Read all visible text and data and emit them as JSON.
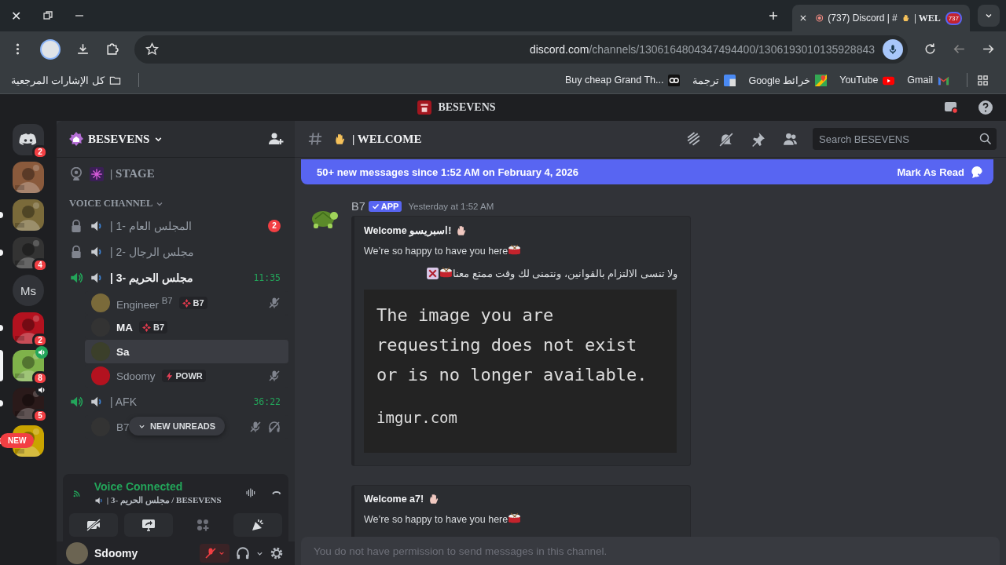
{
  "browser": {
    "window_close": "✕",
    "tab": {
      "title": "(737) Discord | #",
      "title_end": "| WEL",
      "badge": "737"
    },
    "address": {
      "domain": "discord.com",
      "path": "/channels/1306164804347494400/1306193010135928843"
    },
    "bookmarks": [
      {
        "label": "Buy cheap Grand Th...",
        "kind": "gg"
      },
      {
        "label": "ترجمة",
        "kind": "translate"
      },
      {
        "label": "Google خرائط",
        "kind": "maps"
      },
      {
        "label": "YouTube",
        "kind": "youtube"
      },
      {
        "label": "Gmail",
        "kind": "gmail"
      }
    ],
    "all_bookmarks": "كل الإشارات المرجعية"
  },
  "app_title": "BESEVENS",
  "servers": [
    {
      "kind": "home",
      "badge": "2",
      "unread": false,
      "selected": false,
      "voice": false
    },
    {
      "kind": "picture",
      "unread": false,
      "selected": false,
      "voice": false
    },
    {
      "kind": "picture",
      "unread": true,
      "selected": false,
      "voice": false
    },
    {
      "kind": "picture",
      "badge": "4",
      "unread": true,
      "selected": false,
      "voice": false
    },
    {
      "kind": "text",
      "label": "Ms",
      "unread": false,
      "selected": false,
      "voice": false
    },
    {
      "kind": "picture",
      "badge": "2",
      "unread": true,
      "selected": false,
      "voice": false
    },
    {
      "kind": "picture",
      "badge": "8",
      "unread": false,
      "selected": true,
      "voice": true
    },
    {
      "kind": "picture",
      "badge": "5",
      "unread": true,
      "selected": false,
      "voice": true
    },
    {
      "kind": "picture",
      "pill": "NEW",
      "unread": true,
      "selected": false,
      "voice": false
    }
  ],
  "sidebar": {
    "server_name": "BESEVENS",
    "stage": "| STAGE",
    "category": {
      "label": "VOICE CHANNEL",
      "expanded": true
    },
    "channels": [
      {
        "name": "| المجلس العام -1",
        "kind": "locked",
        "connected": false,
        "badge": "2"
      },
      {
        "name": "| مجلس الرجال -2",
        "kind": "locked",
        "connected": false
      },
      {
        "name": "| مجلس الحريم -3",
        "kind": "live",
        "connected": true,
        "timer": "11:35",
        "members": [
          {
            "name": "Engineer $^{B7}$",
            "tag": {
              "label": "B7",
              "kind": "diamond"
            },
            "muted": true,
            "deafened": false,
            "selected": false
          },
          {
            "name": "MA",
            "tag": {
              "label": "B7",
              "kind": "diamond"
            },
            "muted": false,
            "deafened": false,
            "selected": false
          },
          {
            "name": "Sa",
            "muted": false,
            "deafened": false,
            "selected": true
          },
          {
            "name": "Sdoomy",
            "tag": {
              "label": "POWR",
              "kind": "bolt"
            },
            "muted": true,
            "deafened": false,
            "selected": false
          }
        ]
      },
      {
        "name": "| AFK",
        "kind": "live",
        "connected": false,
        "timer": "36:22",
        "members": [
          {
            "name": "B7",
            "muted": true,
            "deafened": true,
            "selected": false
          }
        ]
      }
    ],
    "new_unreads": "NEW UNREADS",
    "voice": {
      "status": "Voice Connected",
      "location": "| مجلس الحريم -3 / BESEVENS"
    },
    "user": {
      "name": "Sdoomy",
      "muted": true
    }
  },
  "main": {
    "channel": "| WELCOME",
    "search": {
      "placeholder": "Search BESEVENS"
    },
    "banner": {
      "text": "50+ new messages since 1:52 AM on February 4, 2026",
      "action": "Mark As Read"
    },
    "message": {
      "author": "B7",
      "badge": "APP",
      "time": "Yesterday at 1:52 AM",
      "embeds": [
        {
          "title": "Welcome اسبريسو!",
          "lines": [
            {
              "text": "We’re so happy to have you here",
              "kind": "greeting"
            },
            {
              "text": "ولا تنسى الالتزام بالقوانين، ونتمنى لك وقت ممتع معنا",
              "kind": "rules"
            }
          ],
          "image": {
            "lines": [
              "The image you are",
              "requesting does not exist",
              "or is no longer available."
            ],
            "source": "imgur.com"
          }
        },
        {
          "title": "Welcome a7!",
          "lines": [
            {
              "text": "We’re so happy to have you here",
              "kind": "greeting"
            }
          ]
        }
      ]
    },
    "input": {
      "placeholder": "You do not have permission to send messages in this channel."
    }
  }
}
